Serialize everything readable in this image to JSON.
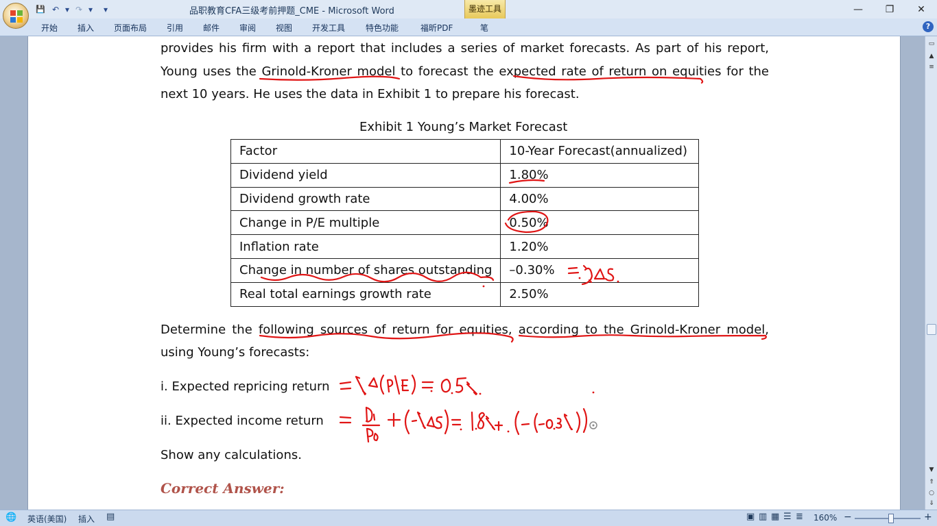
{
  "window": {
    "title": "品职教育CFA三级考前押题_CME - Microsoft Word",
    "contextual_tab": "墨迹工具",
    "minimize": "—",
    "restore": "❐",
    "close": "✕"
  },
  "qat": {
    "save": "💾",
    "undo": "↶",
    "redo": "↷",
    "customize": "▾"
  },
  "ribbon": {
    "tabs": [
      "开始",
      "插入",
      "页面布局",
      "引用",
      "邮件",
      "审阅",
      "视图",
      "开发工具",
      "特色功能",
      "福昕PDF",
      "笔"
    ],
    "help": "?"
  },
  "document": {
    "para1": [
      "provides his firm with a report that includes a series of market forecasts. As part of his report,",
      "Young uses the Grinold-Kroner model to forecast the expected rate of return on equities for the",
      "next 10 years. He uses the data in Exhibit 1 to prepare his forecast."
    ],
    "exhibit_caption": "Exhibit 1 Young’s Market Forecast",
    "table": {
      "header": [
        "Factor",
        "10-Year Forecast(annualized)"
      ],
      "rows": [
        [
          "Dividend yield",
          "1.80%"
        ],
        [
          "Dividend growth rate",
          "4.00%"
        ],
        [
          "Change in P/E multiple",
          "0.50%"
        ],
        [
          "Inflation rate",
          "1.20%"
        ],
        [
          "Change in number of shares outstanding",
          "–0.30%"
        ],
        [
          "Real total earnings growth rate",
          "2.50%"
        ]
      ]
    },
    "para2": [
      "Determine the following sources of return for equities, according to the Grinold-Kroner model,",
      "using Young’s forecasts:"
    ],
    "item1": "i. Expected repricing return",
    "item2": "ii. Expected income return",
    "show_calc": "Show any calculations.",
    "correct_answer": "Correct Answer:"
  },
  "statusbar": {
    "language": "英语(美国)",
    "mode": "插入",
    "zoom": "160%",
    "zoom_out": "−",
    "zoom_in": "+"
  },
  "icons": {
    "office": "office-logo",
    "language": "globe-check-icon",
    "macro": "macro-record-icon"
  }
}
